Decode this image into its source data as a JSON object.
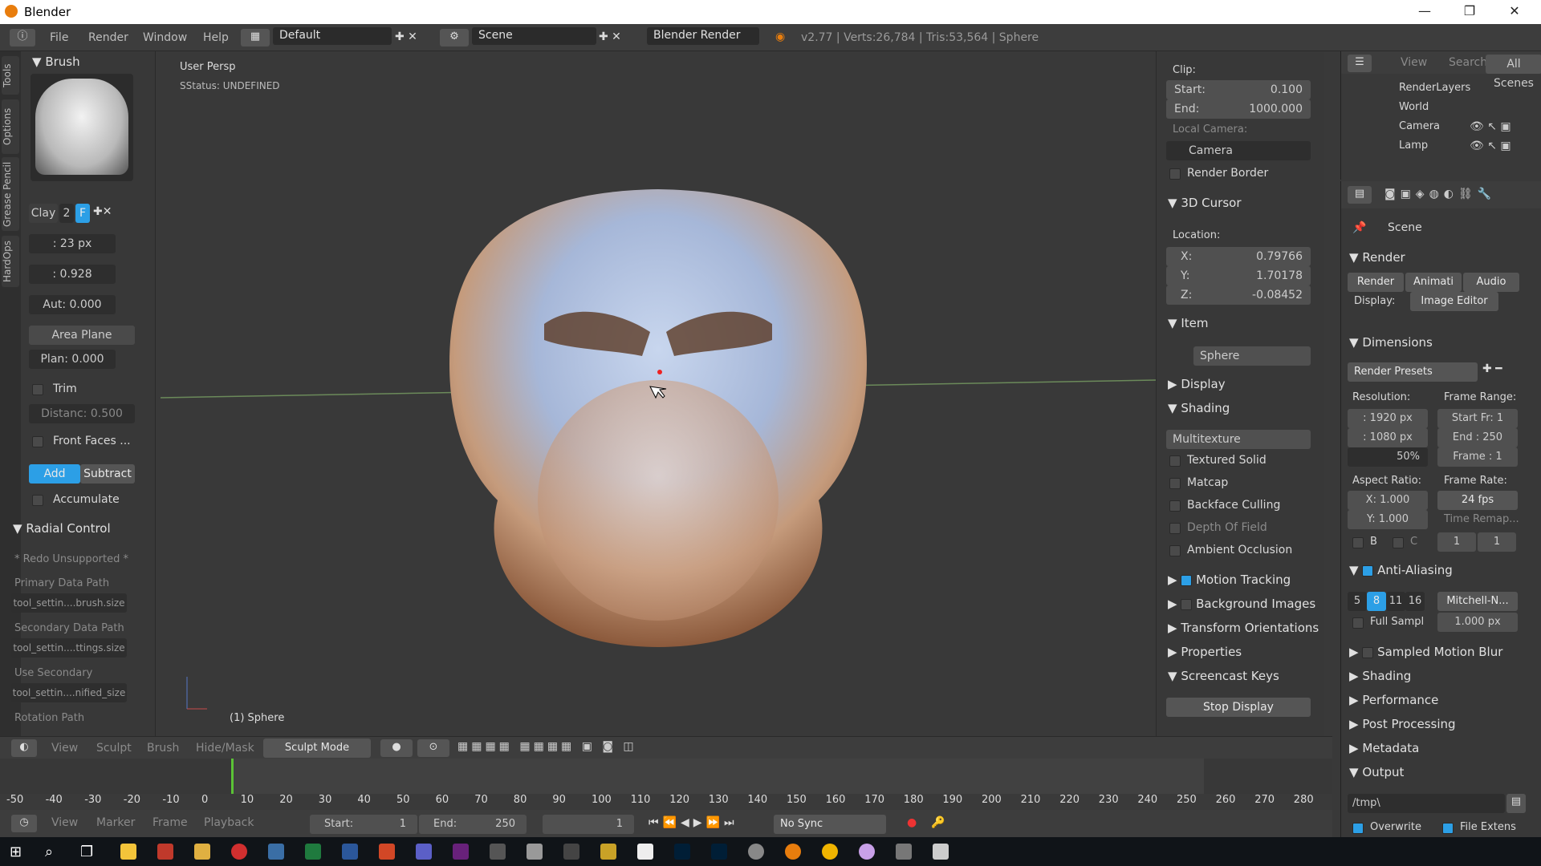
{
  "window": {
    "title": "Blender",
    "min": "—",
    "max": "❐",
    "close": "✕"
  },
  "menu": {
    "file": "File",
    "render": "Render",
    "window": "Window",
    "help": "Help"
  },
  "layout": "Default",
  "scene": "Scene",
  "engine": "Blender Render",
  "stats": "v2.77 | Verts:26,784 | Tris:53,564 | Sphere",
  "vtabs": [
    "Tools",
    "Options",
    "Grease Pencil",
    "HardOps"
  ],
  "brush": {
    "header": "Brush",
    "name": "Clay",
    "users": "2",
    "fake": "F",
    "radius": ": 23 px",
    "strength": ": 0.928",
    "autosmooth": "Aut: 0.000",
    "plane": "Area Plane",
    "plane_offset": "Plan: 0.000",
    "trim": "Trim",
    "distance": "Distanc: 0.500",
    "front_faces": "Front Faces ...",
    "add": "Add",
    "subtract": "Subtract",
    "accumulate": "Accumulate"
  },
  "radial": {
    "header": "Radial Control",
    "redo": "* Redo Unsupported *",
    "primary": "Primary Data Path",
    "primary_val": "tool_settin....brush.size",
    "secondary": "Secondary Data Path",
    "secondary_val": "tool_settin....ttings.size",
    "use_secondary": "Use Secondary",
    "use_secondary_val": "tool_settin....nified_size",
    "rotation": "Rotation Path"
  },
  "viewport": {
    "persp": "User Persp",
    "status": "SStatus: UNDEFINED",
    "object": "(1) Sphere"
  },
  "npanel": {
    "clip": "Clip:",
    "start_l": "Start:",
    "start_v": "0.100",
    "end_l": "End:",
    "end_v": "1000.000",
    "local_camera": "Local Camera:",
    "camera": "Camera",
    "render_border": "Render Border",
    "cursor": "3D Cursor",
    "location": "Location:",
    "x_l": "X:",
    "x": "0.79766",
    "y_l": "Y:",
    "y": "1.70178",
    "z_l": "Z:",
    "z": "-0.08452",
    "item": "Item",
    "item_name": "Sphere",
    "display": "Display",
    "shading": "Shading",
    "shading_mode": "Multitexture",
    "textured_solid": "Textured Solid",
    "matcap": "Matcap",
    "backface": "Backface Culling",
    "dof": "Depth Of Field",
    "ao": "Ambient Occlusion",
    "motion_tracking": "Motion Tracking",
    "background_images": "Background Images",
    "transform_orient": "Transform Orientations",
    "properties": "Properties",
    "screencast": "Screencast Keys",
    "stop_display": "Stop Display"
  },
  "outliner": {
    "view": "View",
    "search": "Search",
    "all_scenes": "All Scenes",
    "items": [
      "RenderLayers",
      "World",
      "Camera",
      "Lamp"
    ]
  },
  "props": {
    "scene": "Scene",
    "render": "Render",
    "render_btn": "Render",
    "anim_btn": "Animati",
    "audio_btn": "Audio",
    "display_l": "Display:",
    "display_v": "Image Editor",
    "dimensions": "Dimensions",
    "presets": "Render Presets",
    "resolution": "Resolution:",
    "res_x": ": 1920 px",
    "res_y": ": 1080 px",
    "res_pct": "50%",
    "frame_range": "Frame Range:",
    "start_fr": "Start Fr: 1",
    "end_fr": "End : 250",
    "frame": "Frame : 1",
    "aspect": "Aspect Ratio:",
    "ax": "X:  1.000",
    "ay": "Y:  1.000",
    "frame_rate": "Frame Rate:",
    "fps": "24 fps",
    "time_remap": "Time Remap...",
    "tr1": "1",
    "tr2": "1",
    "b": "B",
    "c": "C",
    "aa": "Anti-Aliasing",
    "aa5": "5",
    "aa8": "8",
    "aa11": "11",
    "aa16": "16",
    "filter": "Mitchell-N...",
    "full_sample": "Full Sampl",
    "filter_size": "1.000 px",
    "motion_blur": "Sampled Motion Blur",
    "shading": "Shading",
    "performance": "Performance",
    "post": "Post Processing",
    "metadata": "Metadata",
    "output": "Output",
    "path": "/tmp\\",
    "overwrite": "Overwrite",
    "file_ext": "File Extens"
  },
  "vphdr": {
    "view": "View",
    "sculpt": "Sculpt",
    "brush": "Brush",
    "hide": "Hide/Mask",
    "mode": "Sculpt Mode"
  },
  "timeline": {
    "ticks": [
      "-50",
      "-40",
      "-30",
      "-20",
      "-10",
      "0",
      "10",
      "20",
      "30",
      "40",
      "50",
      "60",
      "70",
      "80",
      "90",
      "100",
      "110",
      "120",
      "130",
      "140",
      "150",
      "160",
      "170",
      "180",
      "190",
      "200",
      "210",
      "220",
      "230",
      "240",
      "250",
      "260",
      "270",
      "280"
    ],
    "view": "View",
    "marker": "Marker",
    "frame": "Frame",
    "playback": "Playback",
    "start": "Start:",
    "start_v": "1",
    "end": "End:",
    "end_v": "250",
    "current": "1",
    "sync": "No Sync"
  }
}
